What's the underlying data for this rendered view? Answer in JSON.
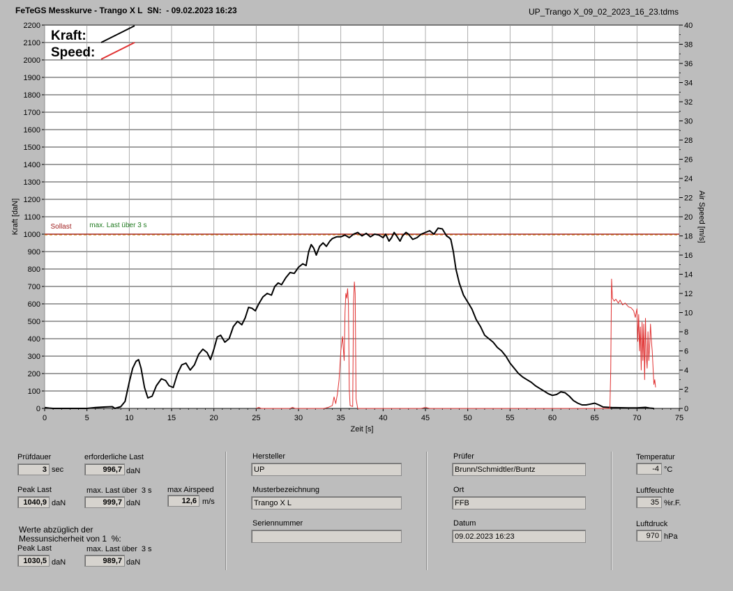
{
  "header": {
    "title": "FeTeGS Messkurve - Trango X L  SN:  - 09.02.2023 16:23",
    "filename": "UP_Trango X_09_02_2023_16_23.tdms"
  },
  "chart_data": {
    "type": "line",
    "xlabel": "Zeit [s]",
    "ylabel": "Kraft [daN]",
    "y2label": "Air Speed [m/s]",
    "xlim": [
      0,
      75
    ],
    "ylim": [
      0,
      2200
    ],
    "y2lim": [
      0,
      40
    ],
    "x_ticks": [
      0,
      5,
      10,
      15,
      20,
      25,
      30,
      35,
      40,
      45,
      50,
      55,
      60,
      65,
      70,
      75
    ],
    "y_ticks": [
      0,
      100,
      200,
      300,
      400,
      500,
      600,
      700,
      800,
      900,
      1000,
      1100,
      1200,
      1300,
      1400,
      1500,
      1600,
      1700,
      1800,
      1900,
      2000,
      2100,
      2200
    ],
    "y2_ticks": [
      0,
      2,
      4,
      6,
      8,
      10,
      12,
      14,
      16,
      18,
      20,
      22,
      24,
      26,
      28,
      30,
      32,
      34,
      36,
      38,
      40
    ],
    "grid": true,
    "legend": {
      "position": "top-left",
      "kraft_label": "Kraft:",
      "speed_label": "Speed:"
    },
    "colors": {
      "kraft": "#000000",
      "speed": "#e03030",
      "sollast": "#a02020",
      "maxlast": "#207a20",
      "plot_bg": "#ffffff"
    },
    "reference_lines": [
      {
        "name": "Sollast",
        "value": 1000,
        "color": "#a02020"
      },
      {
        "name": "max. Last über  3 s",
        "value": 999.7,
        "color": "#207a20"
      }
    ],
    "series": [
      {
        "name": "Kraft",
        "axis": "left",
        "points": [
          [
            0,
            5
          ],
          [
            0.5,
            2
          ],
          [
            1,
            0
          ],
          [
            5,
            0
          ],
          [
            6,
            5
          ],
          [
            7,
            8
          ],
          [
            8,
            10
          ],
          [
            8.3,
            0
          ],
          [
            9,
            10
          ],
          [
            9.5,
            40
          ],
          [
            10,
            150
          ],
          [
            10.4,
            230
          ],
          [
            10.8,
            270
          ],
          [
            11.1,
            280
          ],
          [
            11.4,
            230
          ],
          [
            11.8,
            120
          ],
          [
            12.2,
            60
          ],
          [
            12.7,
            70
          ],
          [
            13.2,
            130
          ],
          [
            13.8,
            170
          ],
          [
            14.3,
            160
          ],
          [
            14.7,
            130
          ],
          [
            15.2,
            120
          ],
          [
            15.7,
            200
          ],
          [
            16.2,
            250
          ],
          [
            16.7,
            260
          ],
          [
            17.2,
            220
          ],
          [
            17.7,
            250
          ],
          [
            18.2,
            310
          ],
          [
            18.7,
            340
          ],
          [
            19.2,
            320
          ],
          [
            19.6,
            280
          ],
          [
            20,
            340
          ],
          [
            20.4,
            410
          ],
          [
            20.8,
            420
          ],
          [
            21.3,
            380
          ],
          [
            21.8,
            400
          ],
          [
            22.3,
            470
          ],
          [
            22.8,
            500
          ],
          [
            23.3,
            480
          ],
          [
            23.7,
            520
          ],
          [
            24.1,
            580
          ],
          [
            24.5,
            575
          ],
          [
            24.9,
            560
          ],
          [
            25.3,
            600
          ],
          [
            25.8,
            640
          ],
          [
            26.3,
            660
          ],
          [
            26.8,
            650
          ],
          [
            27.2,
            700
          ],
          [
            27.6,
            720
          ],
          [
            28,
            710
          ],
          [
            28.5,
            750
          ],
          [
            29,
            780
          ],
          [
            29.5,
            775
          ],
          [
            30,
            810
          ],
          [
            30.5,
            830
          ],
          [
            30.9,
            820
          ],
          [
            31.2,
            900
          ],
          [
            31.5,
            940
          ],
          [
            31.8,
            920
          ],
          [
            32.1,
            880
          ],
          [
            32.5,
            930
          ],
          [
            32.9,
            950
          ],
          [
            33.3,
            930
          ],
          [
            33.7,
            960
          ],
          [
            34,
            975
          ],
          [
            34.5,
            985
          ],
          [
            35,
            985
          ],
          [
            35.5,
            995
          ],
          [
            36,
            980
          ],
          [
            36.5,
            1000
          ],
          [
            37,
            1010
          ],
          [
            37.5,
            990
          ],
          [
            38,
            1005
          ],
          [
            38.5,
            985
          ],
          [
            39,
            1000
          ],
          [
            39.5,
            995
          ],
          [
            40,
            980
          ],
          [
            40.3,
            1000
          ],
          [
            40.7,
            960
          ],
          [
            41,
            980
          ],
          [
            41.3,
            1010
          ],
          [
            41.6,
            990
          ],
          [
            42,
            960
          ],
          [
            42.3,
            990
          ],
          [
            42.7,
            1010
          ],
          [
            43,
            1000
          ],
          [
            43.5,
            970
          ],
          [
            44,
            980
          ],
          [
            44.5,
            1000
          ],
          [
            45,
            1010
          ],
          [
            45.5,
            1020
          ],
          [
            46,
            1000
          ],
          [
            46.5,
            1035
          ],
          [
            47,
            1030
          ],
          [
            47.5,
            990
          ],
          [
            47.8,
            980
          ],
          [
            48,
            970
          ],
          [
            48.3,
            900
          ],
          [
            48.6,
            800
          ],
          [
            49,
            720
          ],
          [
            49.5,
            650
          ],
          [
            50,
            610
          ],
          [
            50.5,
            570
          ],
          [
            51,
            510
          ],
          [
            51.5,
            470
          ],
          [
            52,
            420
          ],
          [
            52.5,
            400
          ],
          [
            53,
            380
          ],
          [
            53.5,
            350
          ],
          [
            54,
            330
          ],
          [
            54.5,
            300
          ],
          [
            55,
            260
          ],
          [
            55.5,
            230
          ],
          [
            56,
            200
          ],
          [
            56.5,
            180
          ],
          [
            57,
            165
          ],
          [
            57.5,
            150
          ],
          [
            58,
            130
          ],
          [
            58.5,
            115
          ],
          [
            59,
            100
          ],
          [
            59.5,
            85
          ],
          [
            60,
            75
          ],
          [
            60.5,
            80
          ],
          [
            61,
            95
          ],
          [
            61.5,
            90
          ],
          [
            62,
            70
          ],
          [
            62.5,
            45
          ],
          [
            63,
            30
          ],
          [
            63.5,
            20
          ],
          [
            64,
            20
          ],
          [
            64.5,
            25
          ],
          [
            65,
            30
          ],
          [
            65.5,
            20
          ],
          [
            66,
            8
          ],
          [
            67,
            5
          ],
          [
            68,
            4
          ],
          [
            69,
            3
          ],
          [
            70,
            3
          ],
          [
            71,
            6
          ],
          [
            71.5,
            2
          ],
          [
            72,
            0
          ]
        ]
      },
      {
        "name": "Speed",
        "axis": "right",
        "points": [
          [
            25,
            0
          ],
          [
            25.3,
            0.1
          ],
          [
            25.6,
            0
          ],
          [
            29,
            0
          ],
          [
            29.3,
            0.1
          ],
          [
            29.6,
            0
          ],
          [
            33,
            0
          ],
          [
            33.5,
            0.1
          ],
          [
            34,
            0.3
          ],
          [
            34.2,
            1.2
          ],
          [
            34.4,
            0.5
          ],
          [
            34.6,
            1.5
          ],
          [
            34.8,
            3
          ],
          [
            35,
            6
          ],
          [
            35.2,
            7.5
          ],
          [
            35.4,
            5
          ],
          [
            35.5,
            10
          ],
          [
            35.6,
            12
          ],
          [
            35.7,
            11.5
          ],
          [
            35.8,
            12.5
          ],
          [
            35.9,
            11
          ],
          [
            36,
            2
          ],
          [
            36.1,
            0.3
          ],
          [
            36.4,
            0.2
          ],
          [
            36.5,
            11
          ],
          [
            36.6,
            13.2
          ],
          [
            36.7,
            12
          ],
          [
            36.8,
            1
          ],
          [
            37,
            0
          ],
          [
            44.5,
            0
          ],
          [
            45,
            0.1
          ],
          [
            45.5,
            0
          ],
          [
            55,
            0
          ],
          [
            66.8,
            0
          ],
          [
            66.9,
            4
          ],
          [
            67,
            13.5
          ],
          [
            67.1,
            11.5
          ],
          [
            67.3,
            11.2
          ],
          [
            67.5,
            11.4
          ],
          [
            67.8,
            11
          ],
          [
            68,
            11.3
          ],
          [
            68.3,
            10.8
          ],
          [
            68.6,
            11
          ],
          [
            69,
            10.6
          ],
          [
            69.3,
            10.5
          ],
          [
            69.6,
            10.2
          ],
          [
            69.8,
            9.5
          ],
          [
            70,
            10.4
          ],
          [
            70.1,
            7
          ],
          [
            70.2,
            9.8
          ],
          [
            70.3,
            6
          ],
          [
            70.4,
            8.5
          ],
          [
            70.5,
            4
          ],
          [
            70.6,
            9
          ],
          [
            70.7,
            5
          ],
          [
            70.8,
            8.8
          ],
          [
            70.9,
            3
          ],
          [
            71,
            9.4
          ],
          [
            71.1,
            5.5
          ],
          [
            71.2,
            4.2
          ],
          [
            71.3,
            8
          ],
          [
            71.4,
            5
          ],
          [
            71.5,
            6.5
          ],
          [
            71.6,
            8.8
          ],
          [
            71.7,
            7
          ],
          [
            71.8,
            6
          ],
          [
            71.9,
            4.2
          ],
          [
            72,
            2.5
          ],
          [
            72.1,
            3
          ],
          [
            72.2,
            2.2
          ]
        ]
      }
    ]
  },
  "panel": {
    "pruefdauer": {
      "label": "Prüfdauer",
      "value": "3",
      "unit": "sec"
    },
    "erforderliche_last": {
      "label": "erforderliche Last",
      "value": "996,7",
      "unit": "daN"
    },
    "peak_last": {
      "label": "Peak Last",
      "value": "1040,9",
      "unit": "daN"
    },
    "max_last_3s": {
      "label": "max. Last über  3 s",
      "value": "999,7",
      "unit": "daN"
    },
    "max_airspeed": {
      "label": "max Airspeed",
      "value": "12,6",
      "unit": "m/s"
    },
    "werte_note": "Werte abzüglich der\nMessunsicherheit von 1  %:",
    "peak_last_corr": {
      "label": "Peak Last",
      "value": "1030,5",
      "unit": "daN"
    },
    "max_last_3s_corr": {
      "label": "max. Last über  3 s",
      "value": "989,7",
      "unit": "daN"
    },
    "hersteller": {
      "label": "Hersteller",
      "value": "UP"
    },
    "musterbezeichnung": {
      "label": "Musterbezeichnung",
      "value": "Trango X L"
    },
    "seriennummer": {
      "label": "Seriennummer",
      "value": ""
    },
    "pruefer": {
      "label": "Prüfer",
      "value": "Brunn/Schmidtler/Buntz"
    },
    "ort": {
      "label": "Ort",
      "value": "FFB"
    },
    "datum": {
      "label": "Datum",
      "value": "09.02.2023 16:23"
    },
    "temperatur": {
      "label": "Temperatur",
      "value": "-4",
      "unit": "°C"
    },
    "luftfeuchte": {
      "label": "Luftfeuchte",
      "value": "35",
      "unit": "%r.F."
    },
    "luftdruck": {
      "label": "Luftdruck",
      "value": "970",
      "unit": "hPa"
    }
  }
}
